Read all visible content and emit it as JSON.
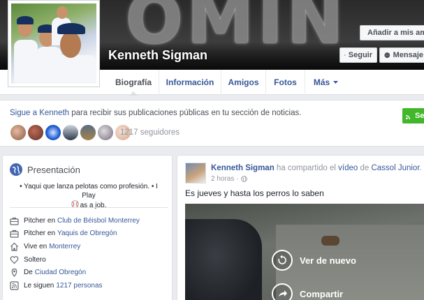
{
  "profile": {
    "name": "Kenneth Sigman",
    "cover_text": "OMIN"
  },
  "cover_buttons": {
    "add_friend": "Añadir a mis amigos",
    "follow": "Seguir",
    "message": "Mensaje"
  },
  "tabs": [
    {
      "label": "Biografía",
      "active": true
    },
    {
      "label": "Información",
      "active": false
    },
    {
      "label": "Amigos",
      "active": false
    },
    {
      "label": "Fotos",
      "active": false
    },
    {
      "label": "Más",
      "active": false
    }
  ],
  "follow_panel": {
    "prefix": "Sigue a Kenneth",
    "rest": " para recibir sus publicaciones públicas en tu sección de noticias.",
    "followers": "1217 seguidores",
    "button": "Se"
  },
  "intro": {
    "title": "Presentación",
    "bio_line1": "• Yaqui que lanza pelotas como profesión. • I Play",
    "bio_line2": "as a job.",
    "items": [
      {
        "icon": "briefcase-icon",
        "text": "Pitcher en",
        "link": "Club de Béisbol Monterrey"
      },
      {
        "icon": "briefcase-icon",
        "text": "Pitcher en",
        "link": "Yaquis de Obregón"
      },
      {
        "icon": "home-icon",
        "text": "Vive en",
        "link": "Monterrey"
      },
      {
        "icon": "heart-icon",
        "text": "Soltero",
        "link": ""
      },
      {
        "icon": "location-pin-icon",
        "text": "De",
        "link": "Ciudad Obregón"
      },
      {
        "icon": "rss-icon",
        "text": "Le siguen",
        "link": "1217 personas"
      }
    ]
  },
  "post": {
    "author": "Kenneth Sigman",
    "action_prefix": " ha compartido el ",
    "object": "vídeo",
    "object_suffix": " de ",
    "source": "Cassol Junior",
    "period": ".",
    "time": "2 horas ·",
    "text": "Es jueves y hasta los perros lo saben",
    "video_replay": "Ver de nuevo",
    "video_share": "Compartir"
  },
  "colors": {
    "link": "#365899",
    "green": "#42b72a",
    "background": "#e9ebee"
  }
}
